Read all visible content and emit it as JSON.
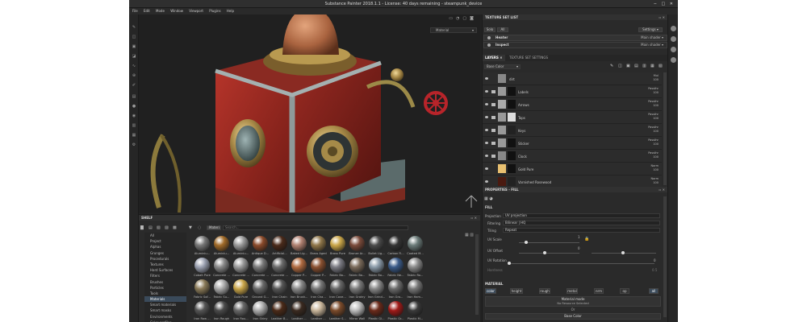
{
  "title": "Substance Painter 2018.1.1 - License: 40 days remaining - steampunk_device",
  "window_controls": "− □ ✕",
  "menu": [
    "File",
    "Edit",
    "Mode",
    "Window",
    "Viewport",
    "Plugins",
    "Help"
  ],
  "viewport": {
    "mode": "Material"
  },
  "texture_set_list": {
    "title": "TEXTURE SET LIST",
    "buttons": [
      "Solo",
      "All"
    ],
    "settings": "Settings ▾",
    "rows": [
      {
        "name": "Heater",
        "shader": "Main shader ▾"
      },
      {
        "name": "Inspect",
        "shader": "Main shader ▾"
      }
    ]
  },
  "tabs": {
    "layers": "LAYERS",
    "settings": "TEXTURE SET SETTINGS"
  },
  "layers": {
    "channel": "Base Color",
    "rows": [
      {
        "name": "dirt",
        "blend": "Mul",
        "opacity": "100"
      },
      {
        "name": "Labels",
        "blend": "Passthr",
        "opacity": "100"
      },
      {
        "name": "Arrows",
        "blend": "Passthr",
        "opacity": "100"
      },
      {
        "name": "Tops",
        "blend": "Passthr",
        "opacity": "100"
      },
      {
        "name": "Keys",
        "blend": "Passthr",
        "opacity": "100"
      },
      {
        "name": "Sticker",
        "blend": "Passthr",
        "opacity": "100"
      },
      {
        "name": "Clock",
        "blend": "Passthr",
        "opacity": "100"
      },
      {
        "name": "Gold Pure",
        "blend": "Norm",
        "opacity": "100"
      },
      {
        "name": "Varnished Rosewood",
        "blend": "Norm",
        "opacity": "100"
      }
    ]
  },
  "shelf": {
    "title": "SHELF",
    "filter_tag": "Materi",
    "search_placeholder": "Search...",
    "categories": [
      "All",
      "Project",
      "Alphas",
      "Grunges",
      "Procedurals",
      "Textures",
      "Hard Surfaces",
      "Filters",
      "Brushes",
      "Particles",
      "Tools",
      "Materials",
      "Smart materials",
      "Smart masks",
      "Environments",
      "Color profiles"
    ],
    "selected_category": "Materials",
    "materials": [
      [
        "Aluminiu...",
        "Aluminiu...",
        "Aluminiu...",
        "Antique D...",
        "Artificial...",
        "Baked Lig...",
        "Brass Aged",
        "Brass Pure",
        "Bronze Ar...",
        "Bullet Lig...",
        "Carbon Fi...",
        "Coated M..."
      ],
      [
        "Cobalt Pure",
        "Concrete ...",
        "Concrete ...",
        "Concrete ...",
        "Concrete ...",
        "Copper P...",
        "Copper P...",
        "Fabric Ba...",
        "Fabric Ba...",
        "Fabric Bo...",
        "Fabric Ne...",
        "Fabric Ro..."
      ],
      [
        "Fabric Sof...",
        "Fabric Su...",
        "Gold Pure",
        "Ground G...",
        "Iron Chain",
        "Iron Brush...",
        "Iron Cha...",
        "Iron Cove...",
        "Iron Grainy",
        "Iron Grind...",
        "Iron Gro...",
        "Iron Ham..."
      ],
      [
        "Iron Raw ...",
        "Iron Rough",
        "Iron Rou...",
        "Iron Shiny",
        "Leather B...",
        "Leather ...",
        "Leather ...",
        "Leather S...",
        "Mirror Wall",
        "Plastic Gl...",
        "Plastic Gr...",
        "Plastic M..."
      ]
    ]
  },
  "properties": {
    "title": "PROPERTIES - FILL",
    "section": "FILL",
    "projection_label": "Projection",
    "projection_value": "UV projection",
    "filtering_label": "Filtering",
    "filtering_value": "Bilinear | HQ",
    "tiling_label": "Tiling",
    "tiling_value": "Repeat",
    "uv_scale_label": "UV Scale",
    "uv_scale_value": "1",
    "uv_offset_label": "UV Offset",
    "uv_offset_value": "0",
    "uv_rotation_label": "UV Rotation",
    "uv_rotation_value": "0",
    "hardness_label": "Hardness",
    "hardness_value": "0.5",
    "material_section": "MATERIAL",
    "channels": [
      "color",
      "height",
      "rough",
      "metal",
      "nrm",
      "op"
    ],
    "all_label": "all",
    "material_mode_label": "Material mode",
    "no_resource": "No Resource Selected",
    "or": "Or",
    "base_color": "Base Color"
  },
  "colors": {
    "accent": "#3c4c5c",
    "panel": "#2a2a2a"
  }
}
